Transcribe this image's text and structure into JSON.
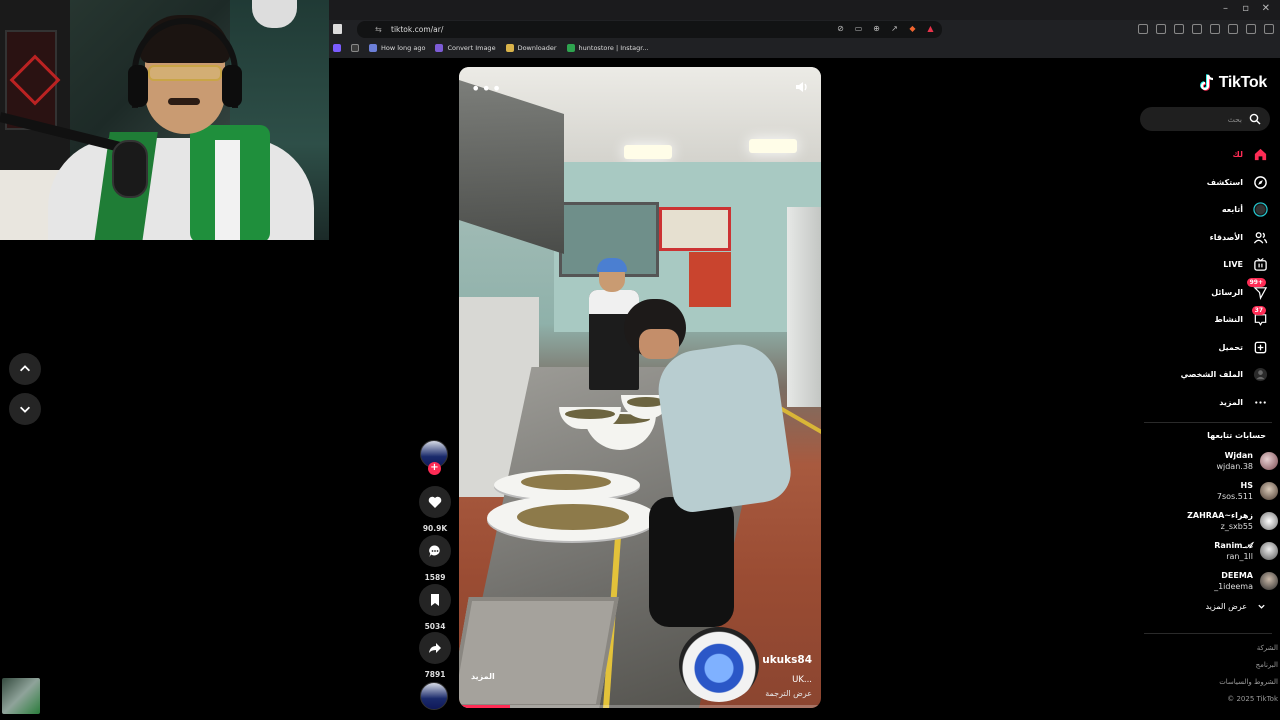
{
  "browser": {
    "url": "tiktok.com/ar/",
    "bookmarks": [
      {
        "label": "How long ago",
        "color": "#6c7fd8"
      },
      {
        "label": "Convert Image",
        "color": "#7d5cd6"
      },
      {
        "label": "Downloader",
        "color": "#d9b34a"
      },
      {
        "label": "huntostore | Instagr...",
        "color": "#2ea44f"
      }
    ]
  },
  "tiktok": {
    "logo_text": "TikTok",
    "search_placeholder": "بحث",
    "menu": [
      {
        "label": "لك",
        "icon": "home-icon",
        "active": true
      },
      {
        "label": "استكشف",
        "icon": "compass-icon"
      },
      {
        "label": "أتابعه",
        "icon": "following-icon"
      },
      {
        "label": "الأصدقاء",
        "icon": "friends-icon"
      },
      {
        "label": "LIVE",
        "icon": "live-icon"
      },
      {
        "label": "الرسائل",
        "icon": "messages-icon",
        "badge": "99+"
      },
      {
        "label": "النشاط",
        "icon": "activity-icon",
        "badge": "37"
      },
      {
        "label": "تحميل",
        "icon": "upload-icon"
      },
      {
        "label": "الملف الشخصي",
        "icon": "profile-icon"
      },
      {
        "label": "المزيد",
        "icon": "more-icon"
      }
    ],
    "following_title": "حسابات تتابعها",
    "following": [
      {
        "name": "Wjdan",
        "handle": "wjdan.38"
      },
      {
        "name": "HS",
        "handle": "7sos.511"
      },
      {
        "name": "ZAHRAA~زهراء",
        "handle": "z_sxb55"
      },
      {
        "name": "Ranimـ𝓐",
        "handle": "ran_1ll"
      },
      {
        "name": "DEEMA",
        "handle": "_1ideema"
      }
    ],
    "see_more": "عرض المزيد",
    "footer": [
      "الشركة",
      "البرنامج",
      "الشروط والسياسات"
    ],
    "copyright": "© 2025 TikTok"
  },
  "video": {
    "author": "ukuks84",
    "description": "UK...",
    "translate": "عرض الترجمة",
    "more": "المزيد",
    "progress": 0.14,
    "likes": "90.9K",
    "comments": "1589",
    "saves": "5034",
    "shares": "7891"
  }
}
